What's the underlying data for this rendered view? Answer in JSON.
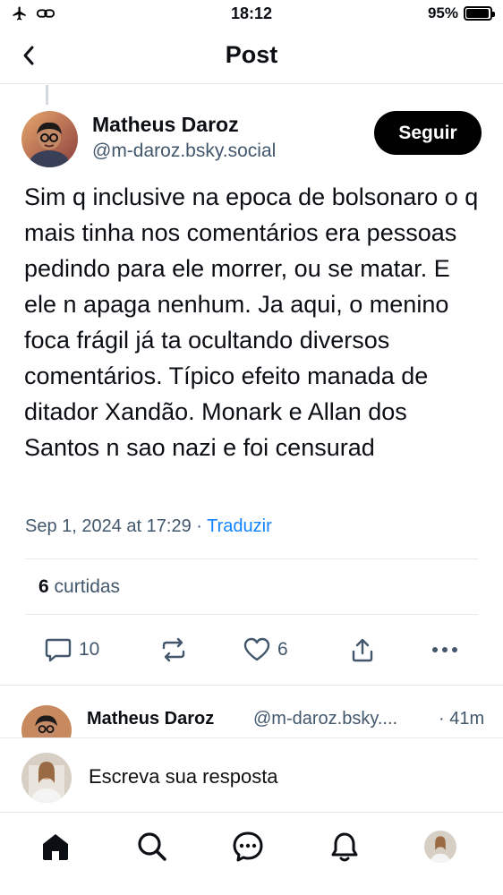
{
  "status_bar": {
    "time": "18:12",
    "battery_text": "95%",
    "battery_level": 0.95
  },
  "header": {
    "title": "Post"
  },
  "post": {
    "author_name": "Matheus Daroz",
    "author_handle": "@m-daroz.bsky.social",
    "follow_label": "Seguir",
    "text": "Sim q inclusive na epoca de bolsonaro o q mais tinha nos comentários era pessoas pedindo para ele morrer, ou se matar. E ele n apaga nenhum. Ja aqui, o menino foca frágil já ta ocultando diversos comentários. Típico efeito manada de ditador Xandão. Monark e Allan dos Santos n sao nazi e foi censurad",
    "timestamp": "Sep 1, 2024 at 17:29",
    "separator": "·",
    "translate_label": "Traduzir",
    "likes_count": "6",
    "likes_label": "curtidas",
    "reply_count": "10",
    "like_count": "6"
  },
  "reply_preview": {
    "author_name": "Matheus Daroz",
    "author_handle": "@m-daroz.bsky....",
    "time": "· 41m"
  },
  "composer": {
    "placeholder": "Escreva sua resposta"
  },
  "colors": {
    "accent": "#1083fe",
    "muted": "#42576c",
    "text": "#0b0f14",
    "button": "#000000"
  }
}
